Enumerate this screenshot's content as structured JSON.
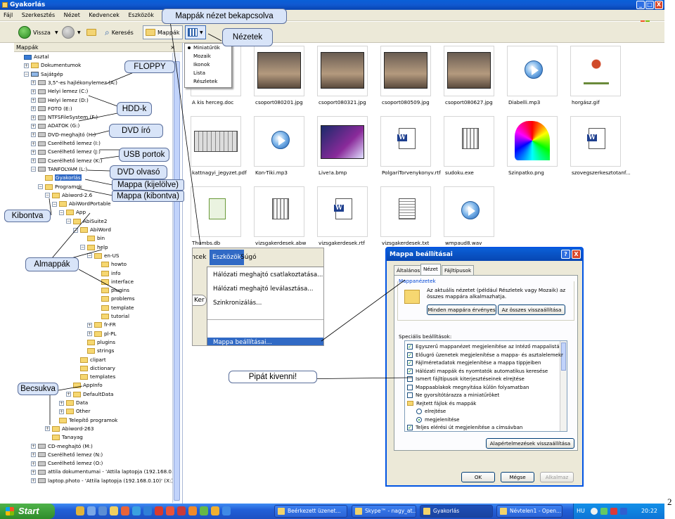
{
  "window": {
    "title": "Gyakorlás",
    "controls": [
      "_",
      "□",
      "X"
    ]
  },
  "menubar": [
    "Fájl",
    "Szerkesztés",
    "Nézet",
    "Kedvencek",
    "Eszközök",
    "S"
  ],
  "toolbar": {
    "back": "Vissza",
    "search": "Keresés",
    "folders": "Mappák"
  },
  "folders_pane": {
    "title": "Mappák",
    "close": "×"
  },
  "tree": [
    {
      "label": "Asztal",
      "indent": 0,
      "pm": "",
      "icon": "desktop"
    },
    {
      "label": "Dokumentumok",
      "indent": 1,
      "pm": "+",
      "icon": "folder"
    },
    {
      "label": "Sajátgép",
      "indent": 1,
      "pm": "-",
      "icon": "computer"
    },
    {
      "label": "3,5\"-es hajlékonylemez (A:)",
      "indent": 2,
      "pm": "+",
      "icon": "drive"
    },
    {
      "label": "Helyi lemez (C:)",
      "indent": 2,
      "pm": "+",
      "icon": "drive"
    },
    {
      "label": "Helyi lemez (D:)",
      "indent": 2,
      "pm": "+",
      "icon": "drive"
    },
    {
      "label": "FOTO (E:)",
      "indent": 2,
      "pm": "+",
      "icon": "drive"
    },
    {
      "label": "NTFSFileSystem (F:)",
      "indent": 2,
      "pm": "+",
      "icon": "drive"
    },
    {
      "label": "ADATOK (G:)",
      "indent": 2,
      "pm": "+",
      "icon": "drive"
    },
    {
      "label": "DVD-meghajtó (H:)",
      "indent": 2,
      "pm": "+",
      "icon": "drive"
    },
    {
      "label": "Cserélhető lemez (I:)",
      "indent": 2,
      "pm": "+",
      "icon": "drive"
    },
    {
      "label": "Cserélhető lemez (J:)",
      "indent": 2,
      "pm": "+",
      "icon": "drive"
    },
    {
      "label": "Cserélhető lemez (K:)",
      "indent": 2,
      "pm": "+",
      "icon": "drive"
    },
    {
      "label": "TANFOLYAM (L:)",
      "indent": 2,
      "pm": "-",
      "icon": "drive"
    },
    {
      "label": "Gyakorlás",
      "indent": 3,
      "pm": "",
      "icon": "folder",
      "selected": true
    },
    {
      "label": "Programok",
      "indent": 3,
      "pm": "-",
      "icon": "folder"
    },
    {
      "label": "Abiword-2.6",
      "indent": 4,
      "pm": "-",
      "icon": "folder"
    },
    {
      "label": "AbiWordPortable",
      "indent": 5,
      "pm": "-",
      "icon": "folder"
    },
    {
      "label": "App",
      "indent": 6,
      "pm": "-",
      "icon": "folder"
    },
    {
      "label": "AbiSuite2",
      "indent": 7,
      "pm": "-",
      "icon": "folder"
    },
    {
      "label": "AbiWord",
      "indent": 8,
      "pm": "-",
      "icon": "folder"
    },
    {
      "label": "bin",
      "indent": 9,
      "pm": "",
      "icon": "folder"
    },
    {
      "label": "help",
      "indent": 9,
      "pm": "-",
      "icon": "folder"
    },
    {
      "label": "en-US",
      "indent": 10,
      "pm": "-",
      "icon": "folder"
    },
    {
      "label": "howto",
      "indent": 11,
      "pm": "",
      "icon": "folder"
    },
    {
      "label": "info",
      "indent": 11,
      "pm": "",
      "icon": "folder"
    },
    {
      "label": "interface",
      "indent": 11,
      "pm": "",
      "icon": "folder"
    },
    {
      "label": "plugins",
      "indent": 11,
      "pm": "",
      "icon": "folder"
    },
    {
      "label": "problems",
      "indent": 11,
      "pm": "",
      "icon": "folder"
    },
    {
      "label": "template",
      "indent": 11,
      "pm": "",
      "icon": "folder"
    },
    {
      "label": "tutorial",
      "indent": 11,
      "pm": "",
      "icon": "folder"
    },
    {
      "label": "fr-FR",
      "indent": 10,
      "pm": "+",
      "icon": "folder"
    },
    {
      "label": "pl-PL",
      "indent": 10,
      "pm": "+",
      "icon": "folder"
    },
    {
      "label": "plugins",
      "indent": 9,
      "pm": "",
      "icon": "folder"
    },
    {
      "label": "strings",
      "indent": 9,
      "pm": "",
      "icon": "folder"
    },
    {
      "label": "clipart",
      "indent": 8,
      "pm": "",
      "icon": "folder"
    },
    {
      "label": "dictionary",
      "indent": 8,
      "pm": "",
      "icon": "folder"
    },
    {
      "label": "templates",
      "indent": 8,
      "pm": "",
      "icon": "folder"
    },
    {
      "label": "AppInfo",
      "indent": 7,
      "pm": "",
      "icon": "folder"
    },
    {
      "label": "DefaultData",
      "indent": 7,
      "pm": "+",
      "icon": "folder"
    },
    {
      "label": "Data",
      "indent": 6,
      "pm": "+",
      "icon": "folder"
    },
    {
      "label": "Other",
      "indent": 6,
      "pm": "+",
      "icon": "folder"
    },
    {
      "label": "Telepítő programok",
      "indent": 5,
      "pm": "",
      "icon": "folder"
    },
    {
      "label": "Abiword-263",
      "indent": 4,
      "pm": "+",
      "icon": "folder"
    },
    {
      "label": "Tanayag",
      "indent": 4,
      "pm": "",
      "icon": "folder"
    },
    {
      "label": "CD-meghajtó (M:)",
      "indent": 2,
      "pm": "+",
      "icon": "drive"
    },
    {
      "label": "Cserélhető lemez (N:)",
      "indent": 2,
      "pm": "+",
      "icon": "drive"
    },
    {
      "label": "Cserélhető lemez (O:)",
      "indent": 2,
      "pm": "+",
      "icon": "drive"
    },
    {
      "label": "attila dokumentumai - 'Attila laptopja (192.168.0.10",
      "indent": 2,
      "pm": "+",
      "icon": "drive"
    },
    {
      "label": "laptop.photo - 'Attila laptopja (192.168.0.10)' (X:)",
      "indent": 2,
      "pm": "+",
      "icon": "drive"
    }
  ],
  "views_menu": {
    "items": [
      "Miniatűrök",
      "Mozaik",
      "Ikonok",
      "Lista",
      "Részletek"
    ],
    "selected": 0
  },
  "files": [
    {
      "name": "A kis herceg.doc",
      "kind": "blank"
    },
    {
      "name": "csoport080201.jpg",
      "kind": "photo"
    },
    {
      "name": "csoport080321.jpg",
      "kind": "photo"
    },
    {
      "name": "csoport080509.jpg",
      "kind": "photo"
    },
    {
      "name": "csoport080627.jpg",
      "kind": "photo"
    },
    {
      "name": "Diabelli.mp3",
      "kind": "media"
    },
    {
      "name": "horgász.gif",
      "kind": "clipart"
    },
    {
      "name": "kattnagyi_jegyzet.pdf",
      "kind": "keyboard"
    },
    {
      "name": "Kon-Tiki.mp3",
      "kind": "media"
    },
    {
      "name": "Live!a.bmp",
      "kind": "poster"
    },
    {
      "name": "PolgariTorvenykonyv.rtf",
      "kind": "word"
    },
    {
      "name": "sudoku.exe",
      "kind": "grid"
    },
    {
      "name": "Szinpatko.png",
      "kind": "color"
    },
    {
      "name": "szovegszerkesztotanf...",
      "kind": "word"
    },
    {
      "name": "Thumbs.db",
      "kind": "db"
    },
    {
      "name": "vizsgakerdesek.abw",
      "kind": "grid"
    },
    {
      "name": "vizsgakerdesek.rtf",
      "kind": "word"
    },
    {
      "name": "vizsgakerdesek.txt",
      "kind": "txt"
    },
    {
      "name": "wmpaud8.wav",
      "kind": "media"
    }
  ],
  "tools_inset": {
    "menubar": [
      "ncek",
      "Eszközök",
      "Súgó"
    ],
    "side": "Ker",
    "items": [
      "Hálózati meghajtó csatlakoztatása...",
      "Hálózati meghajtó leválasztása...",
      "Szinkronizálás...",
      "Mappa beállításai..."
    ]
  },
  "dialog": {
    "title": "Mappa beállításai",
    "title_buttons": [
      "?",
      "X"
    ],
    "tabs": [
      "Általános",
      "Nézet",
      "Fájltípusok"
    ],
    "active_tab": 1,
    "group_views": "Mappanézetek",
    "views_text": "Az aktuális nézetet (például Részletek vagy Mozaik) az összes mappára alkalmazhatja.",
    "btn_apply_all": "Minden mappára érvényes",
    "btn_reset_all": "Az összes visszaállítása",
    "advanced_label": "Speciális beállítások:",
    "advanced": [
      {
        "text": "Egyszerű mappanézet megjelenítése az Intéző mappalistá",
        "type": "cb",
        "checked": true
      },
      {
        "text": "Előugró üzenetek megjelenítése a mappa- és asztalelemekr",
        "type": "cb",
        "checked": true
      },
      {
        "text": "Fájlméretadatok megjelenítése a mappa tippjeiben",
        "type": "cb",
        "checked": true
      },
      {
        "text": "Hálózati mappák és nyomtatók automatikus keresése",
        "type": "cb",
        "checked": true
      },
      {
        "text": "Ismert fájltípusok kiterjesztéseinek elrejtése",
        "type": "cb",
        "checked": false
      },
      {
        "text": "Mappaablakok megnyitása külön folyamatban",
        "type": "cb",
        "checked": false
      },
      {
        "text": "Ne gyorsítótárazza a miniatűröket",
        "type": "cb",
        "checked": false
      },
      {
        "text": "Rejtett fájlok és mappák",
        "type": "folder",
        "checked": false
      },
      {
        "text": "elrejtése",
        "type": "rb",
        "checked": false
      },
      {
        "text": "megjelenítése",
        "type": "rb",
        "checked": true
      },
      {
        "text": "Teljes elérési út megjelenítése a címsávban",
        "type": "cb",
        "checked": true
      }
    ],
    "btn_defaults": "Alapértelmezések visszaállítása",
    "btn_ok": "OK",
    "btn_cancel": "Mégse",
    "btn_apply": "Alkalmaz"
  },
  "callouts": {
    "folders_view": "Mappák nézet bekapcsolva",
    "views": "Nézetek",
    "floppy": "FLOPPY",
    "hdd": "HDD-k",
    "dvd_writer": "DVD író",
    "usb": "USB portok",
    "dvd_reader": "DVD olvasó",
    "selected": "Mappa (kijelölve)",
    "expanded": "Mappa (kibontva)",
    "expand": "Kibontva",
    "subfolders": "Almappák",
    "collapsed": "Becsukva",
    "uncheck": "Pipát kivenni!"
  },
  "taskbar": {
    "start": "Start",
    "tasks": [
      {
        "label": "Beérkezett üzenet...",
        "active": false
      },
      {
        "label": "Skype™ - nagy_at...",
        "active": false
      },
      {
        "label": "Gyakorlás",
        "active": true
      },
      {
        "label": "Névtelen1 - Open...",
        "active": false
      }
    ],
    "lang": "HU",
    "clock": "20:22"
  },
  "page_number": "2"
}
